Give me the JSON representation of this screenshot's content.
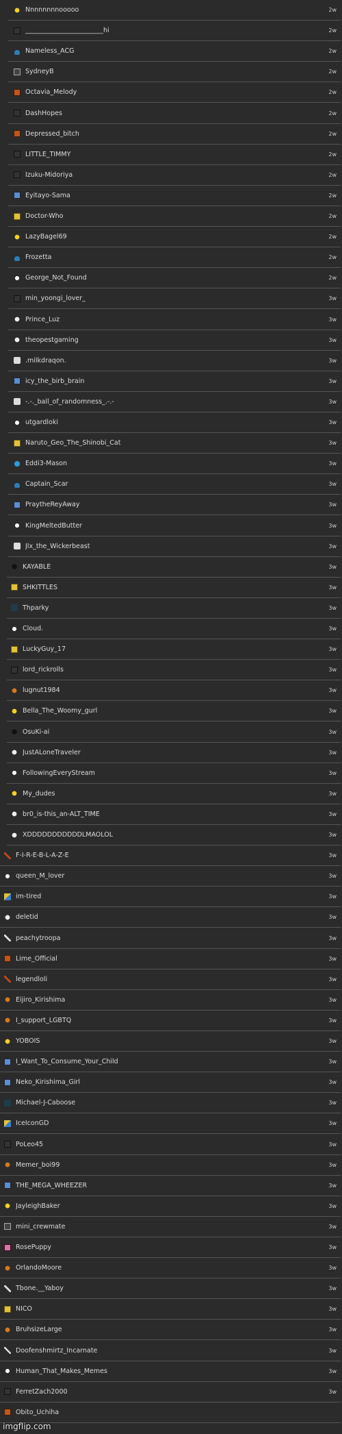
{
  "entries": [
    {
      "name": "Nnnnnnnnooooo",
      "time": "2w",
      "icon": "star-icon"
    },
    {
      "name": "________________________hi",
      "time": "2w",
      "icon": "10k-badge-icon"
    },
    {
      "name": "Nameless_ACG",
      "time": "2w",
      "icon": "cloud-icon"
    },
    {
      "name": "SydneyB",
      "time": "2w",
      "icon": "mono-square-icon"
    },
    {
      "name": "Octavia_Melody",
      "time": "2w",
      "icon": "orange-square-icon"
    },
    {
      "name": "DashHopes",
      "time": "2w",
      "icon": "10k-badge-icon"
    },
    {
      "name": "Depressed_bitch",
      "time": "2w",
      "icon": "orange-square-icon"
    },
    {
      "name": "LITTLE_TIMMY",
      "time": "2w",
      "icon": "10k-badge-icon"
    },
    {
      "name": "Izuku-Midoriya",
      "time": "2w",
      "icon": "10k-badge-icon"
    },
    {
      "name": "Eyitayo-Sama",
      "time": "2w",
      "icon": "blue-square-icon"
    },
    {
      "name": "Doctor-Who",
      "time": "2w",
      "icon": "yellow-square-icon"
    },
    {
      "name": "LazyBagel69",
      "time": "2w",
      "icon": "star-icon"
    },
    {
      "name": "Frozetta",
      "time": "2w",
      "icon": "cloud-icon"
    },
    {
      "name": "George_Not_Found",
      "time": "2w",
      "icon": "white-star-icon"
    },
    {
      "name": "min_yoongi_lover_",
      "time": "3w",
      "icon": "10k-badge-icon"
    },
    {
      "name": "Prince_Luz",
      "time": "3w",
      "icon": "ghost-icon"
    },
    {
      "name": "theopestgaming",
      "time": "3w",
      "icon": "ghost-icon"
    },
    {
      "name": ".milkdraqon.",
      "time": "3w",
      "icon": "speech-icon"
    },
    {
      "name": "icy_the_birb_brain",
      "time": "3w",
      "icon": "blue-square-icon"
    },
    {
      "name": "-.-._ball_of_randomness_.-.-",
      "time": "3w",
      "icon": "speech-icon"
    },
    {
      "name": "utgardloki",
      "time": "3w",
      "icon": "white-star-icon"
    },
    {
      "name": "Naruto_Geo_The_Shinobi_Cat",
      "time": "3w",
      "icon": "yellow-square-icon"
    },
    {
      "name": "Eddi3-Mason",
      "time": "3w",
      "icon": "blue-head-icon"
    },
    {
      "name": "Captain_Scar",
      "time": "3w",
      "icon": "cloud-icon"
    },
    {
      "name": "PraytheReyAway",
      "time": "3w",
      "icon": "blue-square-icon"
    },
    {
      "name": "KingMeltedButter",
      "time": "3w",
      "icon": "white-star-icon"
    },
    {
      "name": "Jlx_the_Wickerbeast",
      "time": "3w",
      "icon": "speech-icon"
    },
    {
      "name": "KAYABLE",
      "time": "3w",
      "icon": "black-star-icon"
    },
    {
      "name": "SHKITTLES",
      "time": "3w",
      "icon": "yellow-square-icon"
    },
    {
      "name": "Thparky",
      "time": "3w",
      "icon": "dark-icon"
    },
    {
      "name": "Cloud.",
      "time": "3w",
      "icon": "white-star-icon"
    },
    {
      "name": "LuckyGuy_17",
      "time": "3w",
      "icon": "yellow-square-icon"
    },
    {
      "name": "lord_rickrolls",
      "time": "3w",
      "icon": "10k-badge-icon"
    },
    {
      "name": "lugnut1984",
      "time": "3w",
      "icon": "orange-ball-icon"
    },
    {
      "name": "Bella_The_Woomy_gurl",
      "time": "3w",
      "icon": "star-icon"
    },
    {
      "name": "OsuKi-ai",
      "time": "3w",
      "icon": "black-star-icon"
    },
    {
      "name": "JustALoneTraveler",
      "time": "3w",
      "icon": "ghost-icon"
    },
    {
      "name": "FollowingEveryStream",
      "time": "3w",
      "icon": "white-star-icon"
    },
    {
      "name": "My_dudes",
      "time": "3w",
      "icon": "star-icon"
    },
    {
      "name": "br0_is-this_an-ALT_TIME",
      "time": "3w",
      "icon": "ghost-icon"
    },
    {
      "name": "XDDDDDDDDDDDLMAOLOL",
      "time": "3w",
      "icon": "ghost-icon"
    },
    {
      "name": "F-I-R-E-B-L-A-Z-E",
      "time": "3w",
      "icon": "feather-icon"
    },
    {
      "name": "queen_M_lover",
      "time": "3w",
      "icon": "white-star-icon"
    },
    {
      "name": "im-tired",
      "time": "3w",
      "icon": "multi-square-icon"
    },
    {
      "name": "deletid",
      "time": "3w",
      "icon": "ghost-icon"
    },
    {
      "name": "peachytroopa",
      "time": "3w",
      "icon": "plane-icon"
    },
    {
      "name": "Lime_Official",
      "time": "3w",
      "icon": "orange-square-icon"
    },
    {
      "name": "legendloli",
      "time": "3w",
      "icon": "feather-icon"
    },
    {
      "name": "Eijiro_Kirishima",
      "time": "3w",
      "icon": "orange-ball-icon"
    },
    {
      "name": "I_support_LGBTQ",
      "time": "3w",
      "icon": "orange-ball-icon"
    },
    {
      "name": "YOBOIS",
      "time": "3w",
      "icon": "star-icon"
    },
    {
      "name": "I_Want_To_Consume_Your_Child",
      "time": "3w",
      "icon": "blue-square-icon"
    },
    {
      "name": "Neko_Kirishima_Girl",
      "time": "3w",
      "icon": "blue-square-icon"
    },
    {
      "name": "Michael-J-Caboose",
      "time": "3w",
      "icon": "dark-icon"
    },
    {
      "name": "IceIconGD",
      "time": "3w",
      "icon": "multi-square-icon"
    },
    {
      "name": "PoLeo45",
      "time": "3w",
      "icon": "10k-badge-icon"
    },
    {
      "name": "Memer_boi99",
      "time": "3w",
      "icon": "orange-ball-icon"
    },
    {
      "name": "THE_MEGA_WHEEZER",
      "time": "3w",
      "icon": "blue-square-icon"
    },
    {
      "name": "JayleighBaker",
      "time": "3w",
      "icon": "star-icon"
    },
    {
      "name": "mini_crewmate",
      "time": "3w",
      "icon": "mono-square-icon"
    },
    {
      "name": "RosePuppy",
      "time": "3w",
      "icon": "pink-square-icon"
    },
    {
      "name": "OrlandoMoore",
      "time": "3w",
      "icon": "orange-ball-icon"
    },
    {
      "name": "Tbone.__Yaboy",
      "time": "3w",
      "icon": "plane-icon"
    },
    {
      "name": "NICO",
      "time": "3w",
      "icon": "yellow-square-icon"
    },
    {
      "name": "BruhsizeLarge",
      "time": "3w",
      "icon": "orange-ball-icon"
    },
    {
      "name": "Doofenshmirtz_Incarnate",
      "time": "3w",
      "icon": "plane-icon"
    },
    {
      "name": "Human_That_Makes_Memes",
      "time": "3w",
      "icon": "white-star-icon"
    },
    {
      "name": "FerretZach2000",
      "time": "3w",
      "icon": "10k-badge-icon"
    },
    {
      "name": "Obito_Uchiha",
      "time": "",
      "icon": "orange-square-icon"
    }
  ],
  "watermark": "imgflip.com"
}
